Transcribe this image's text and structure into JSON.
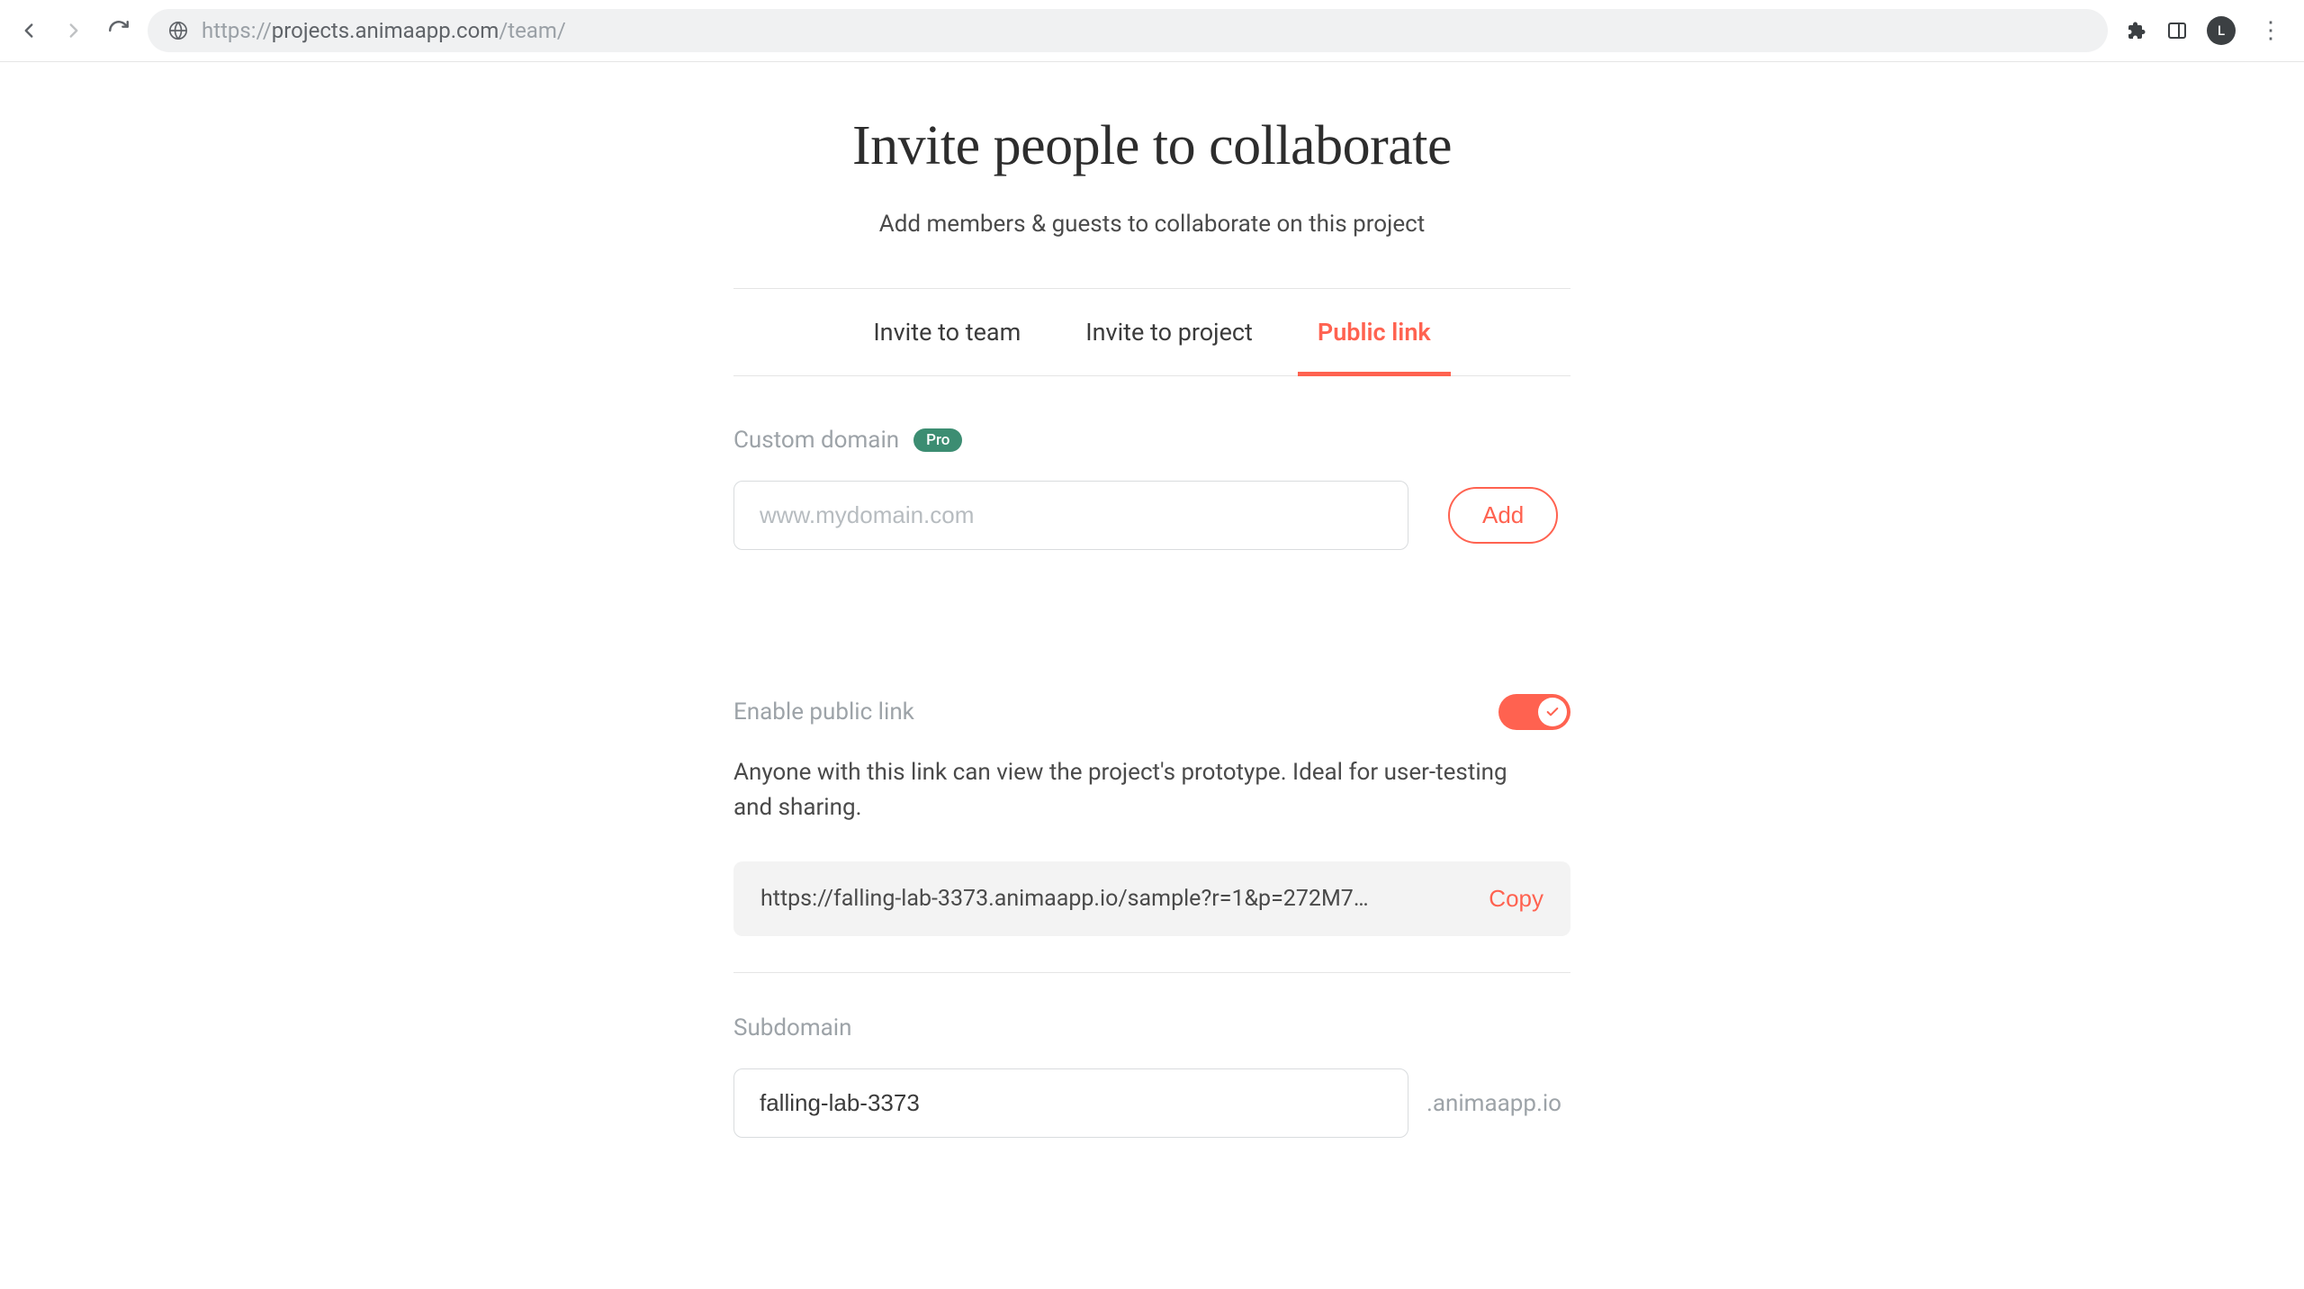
{
  "browser": {
    "url_prefix": "https://",
    "url_host": "projects.animaapp.com",
    "url_path": "/team/",
    "avatar_letter": "L"
  },
  "header": {
    "title": "Invite people to collaborate",
    "subtitle": "Add members & guests to collaborate on this project"
  },
  "tabs": {
    "items": [
      {
        "label": "Invite to team",
        "active": false
      },
      {
        "label": "Invite to project",
        "active": false
      },
      {
        "label": "Public link",
        "active": true
      }
    ]
  },
  "custom_domain": {
    "label": "Custom domain",
    "badge": "Pro",
    "placeholder": "www.mydomain.com",
    "value": "",
    "add_label": "Add"
  },
  "public_link": {
    "enable_label": "Enable public link",
    "enabled": true,
    "description": "Anyone with this link can view the project's prototype. Ideal for user-testing and sharing.",
    "url": "https://falling-lab-3373.animaapp.io/sample?r=1&p=272M7…",
    "copy_label": "Copy"
  },
  "subdomain": {
    "label": "Subdomain",
    "value": "falling-lab-3373",
    "suffix": ".animaapp.io"
  }
}
